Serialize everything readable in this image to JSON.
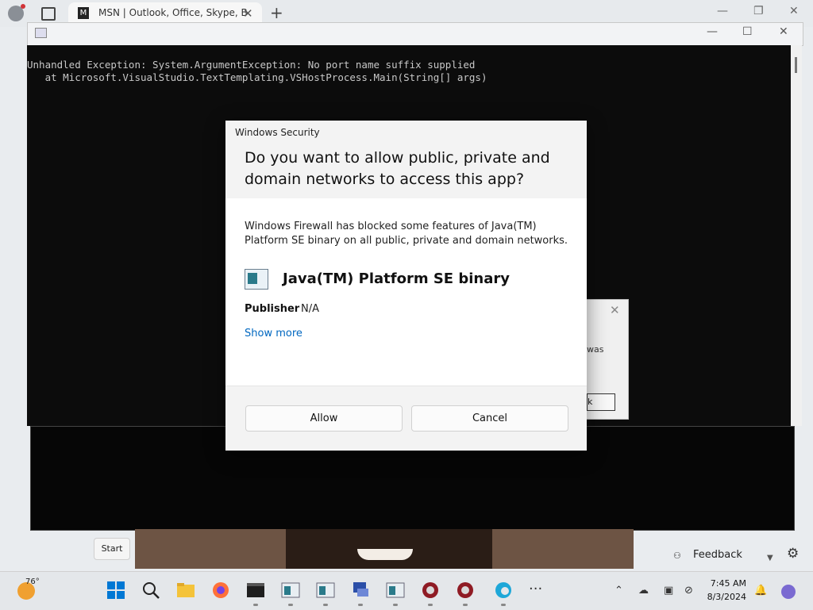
{
  "browser": {
    "tab_title": "MSN | Outlook, Office, Skype, B",
    "tab_favicon": "M",
    "new_tab": "+",
    "tab_close": "✕"
  },
  "console": {
    "lines": [
      "Unhandled Exception: System.ArgumentException: No port name suffix supplied",
      "   at Microsoft.VisualStudio.TextTemplating.VSHostProcess.Main(String[] args)"
    ]
  },
  "behind_dialog": {
    "text": "was",
    "button": "k"
  },
  "dialog": {
    "caption": "Windows Security",
    "question": "Do you want to allow public, private and domain networks to access this app?",
    "body": "Windows Firewall has blocked some features of Java(TM) Platform SE binary on all public, private and domain networks.",
    "app_name": "Java(TM) Platform SE binary",
    "publisher_label": "Publisher",
    "publisher_value": "N/A",
    "show_more": "Show more",
    "allow_label": "Allow",
    "cancel_label": "Cancel"
  },
  "overlay": {
    "start_tooltip": "Start",
    "feedback_label": "Feedback"
  },
  "taskbar": {
    "weather_temp": "76°",
    "time": "7:45 AM",
    "date": "8/3/2024"
  },
  "colors": {
    "link": "#0067c0",
    "console_bg": "#0c0c0c",
    "accent_start": "#0078d4"
  }
}
